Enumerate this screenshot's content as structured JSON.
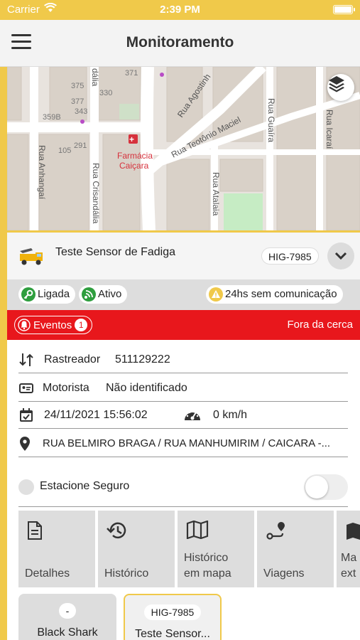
{
  "status_bar": {
    "carrier": "Carrier",
    "time": "2:39 PM"
  },
  "header": {
    "title": "Monitoramento"
  },
  "map": {
    "numbers": [
      "371",
      "375",
      "330",
      "377",
      "343",
      "359B",
      "105",
      "291"
    ],
    "streets": [
      "Rua Agostinh",
      "Rua Teotônio Maciel",
      "Rua Guaíra",
      "Rua Icaraí",
      "Rua Anhangaí",
      "Rua Crisandália",
      "Rua Atalaia",
      "dália"
    ],
    "poi": [
      "Farmácia",
      "Caiçara"
    ]
  },
  "vehicle": {
    "name": "Teste Sensor de Fadiga",
    "plate": "HIG-7985"
  },
  "status": {
    "ignition": "Ligada",
    "active": "Ativo",
    "communication": "24hs sem comunicação"
  },
  "events": {
    "label": "Eventos",
    "count": "1",
    "alert": "Fora da cerca"
  },
  "details": {
    "tracker_label": "Rastreador",
    "tracker_value": "511129222",
    "driver_label": "Motorista",
    "driver_value": "Não identificado",
    "datetime": "24/11/2021 15:56:02",
    "speed": "0 km/h",
    "address": "RUA BELMIRO BRAGA / RUA MANHUMIRIM / CAICARA -..."
  },
  "safe_parking": {
    "label": "Estacione Seguro"
  },
  "actions": [
    {
      "line1": "",
      "line2": "Detalhes"
    },
    {
      "line1": "",
      "line2": "Histórico"
    },
    {
      "line1": "Histórico",
      "line2": "em mapa"
    },
    {
      "line1": "",
      "line2": "Viagens"
    },
    {
      "line1": "Ma",
      "line2": "ext"
    }
  ],
  "vehicle_cards": [
    {
      "plate": "-",
      "title": "Black Shark"
    },
    {
      "plate": "HIG-7985",
      "title": "Teste Sensor..."
    }
  ],
  "colors": {
    "accent": "#f0c94a",
    "alert": "#e8171c",
    "ignition": "#2e9e3e",
    "warning": "#f0c94a"
  }
}
